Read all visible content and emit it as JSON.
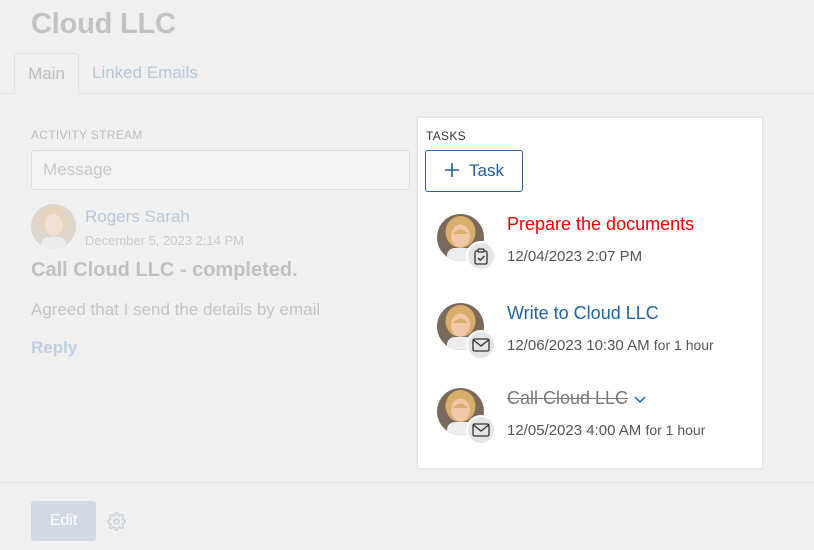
{
  "record": {
    "title": "Cloud LLC",
    "tabs": [
      "Main",
      "Linked Emails"
    ]
  },
  "activity_stream": {
    "label": "ACTIVITY STREAM",
    "message_placeholder": "Message",
    "post": {
      "author": "Rogers Sarah",
      "date": "December 5, 2023 2:14 PM",
      "title": "Call Cloud LLC - completed.",
      "body": "Agreed that I send the details by email",
      "reply_label": "Reply"
    }
  },
  "footer": {
    "edit_label": "Edit",
    "settings_icon": "gear-icon"
  },
  "tasks": {
    "label": "TASKS",
    "add_button_label": "Task",
    "items": [
      {
        "title": "Prepare the documents",
        "status": "overdue",
        "datetime": "12/04/2023 2:07 PM",
        "duration": "",
        "icon": "task-clipboard-icon"
      },
      {
        "title": "Write to Cloud LLC",
        "status": "normal",
        "datetime": "12/06/2023 10:30 AM",
        "duration": "for 1 hour",
        "icon": "email-envelope-icon"
      },
      {
        "title": "Call Cloud LLC",
        "status": "completed",
        "datetime": "12/05/2023 4:00 AM",
        "duration": "for 1 hour",
        "icon": "email-envelope-icon"
      }
    ]
  },
  "colors": {
    "overdue": "#f20000",
    "link": "#1e63a6",
    "button_border": "#2a6496"
  }
}
